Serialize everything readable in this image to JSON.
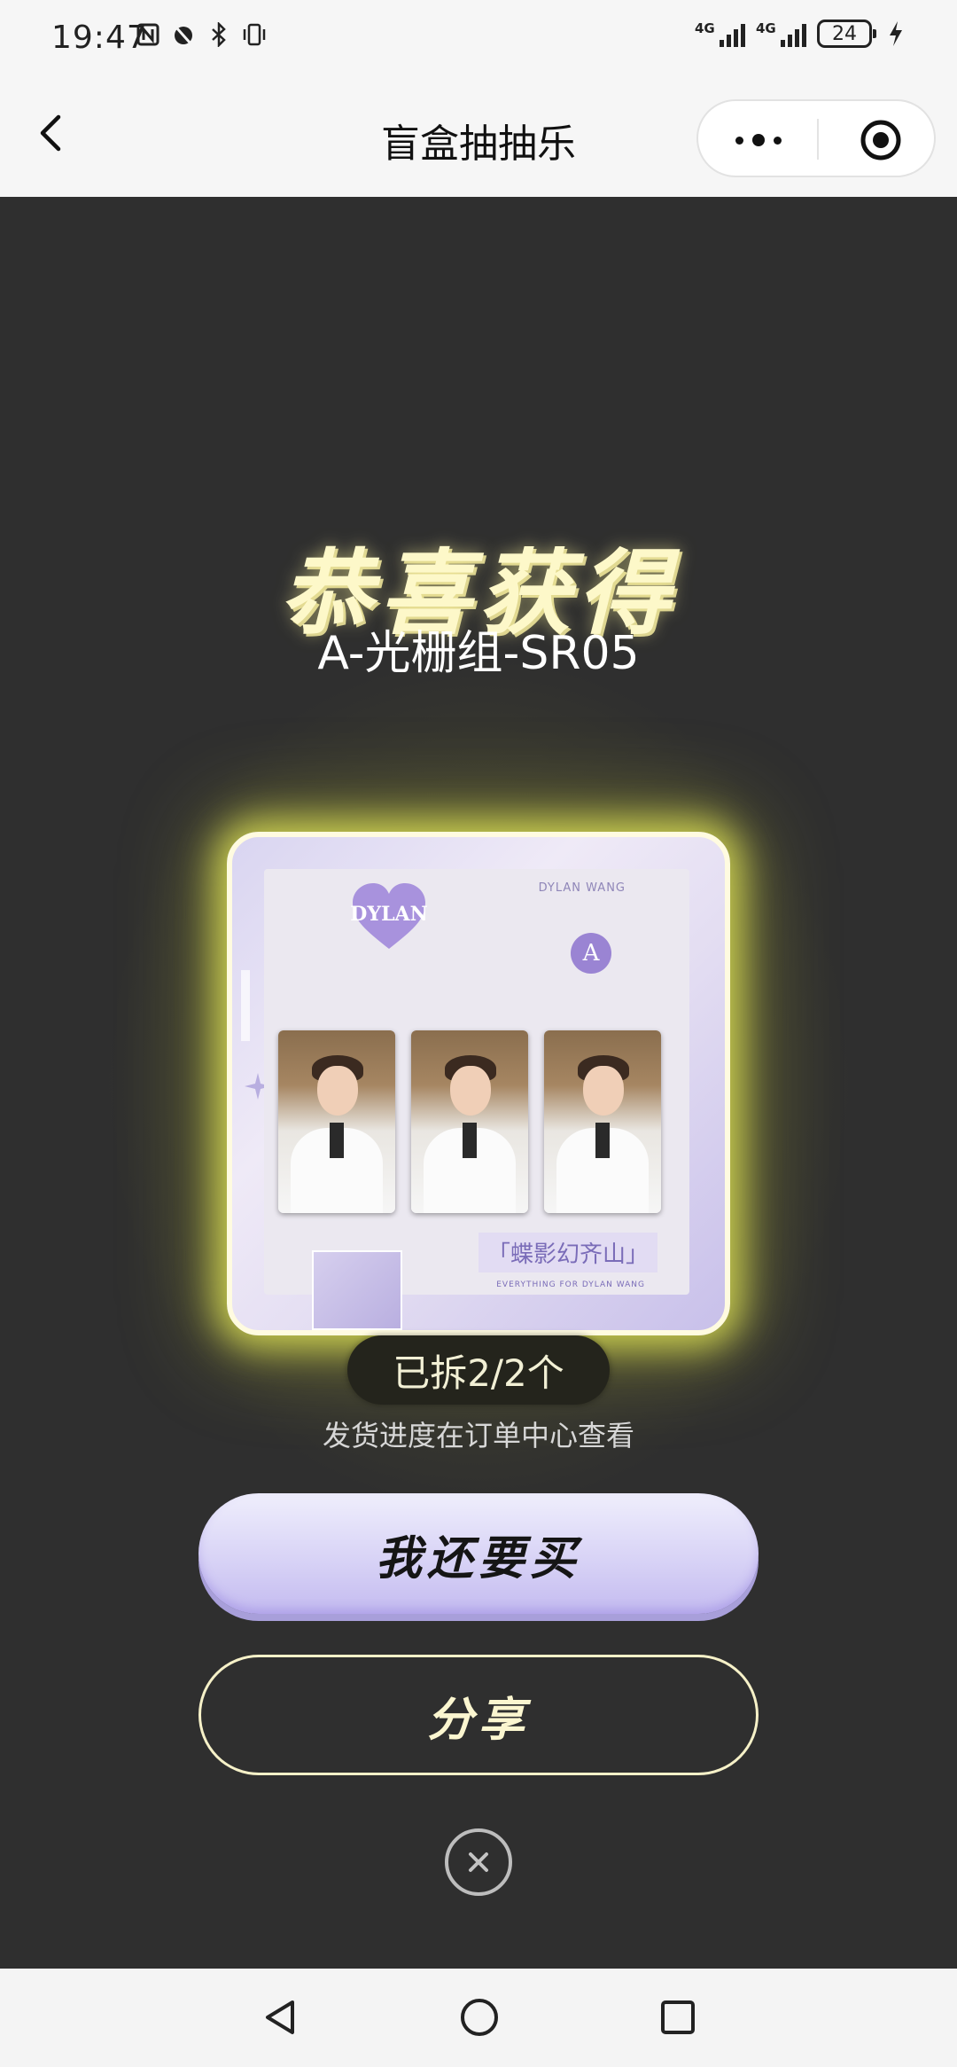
{
  "status_bar": {
    "time": "19:47",
    "network_1": "4G",
    "network_2": "4G",
    "battery": "24",
    "icons": [
      "nfc-icon",
      "alarm-icon",
      "bluetooth-icon",
      "vibrate-icon",
      "charging-icon"
    ]
  },
  "nav": {
    "title": "盲盒抽抽乐",
    "back_icon": "chevron-left-icon",
    "more_icon": "more-dots-icon",
    "target_icon": "target-icon"
  },
  "result": {
    "headline": "恭喜获得",
    "prize_name": "A-光栅组-SR05",
    "card": {
      "heart_text": "DYLAN",
      "brand_text": "DYLAN WANG",
      "badge": "A",
      "title_tag": "「蝶影幻齐山」",
      "footer_text": "EVERYTHING FOR DYLAN WANG"
    },
    "progress": "已拆2/2个",
    "hint": "发货进度在订单中心查看"
  },
  "actions": {
    "buy_again": "我还要买",
    "share": "分享",
    "close_icon": "close-icon"
  },
  "system_nav": {
    "back_icon": "triangle-back-icon",
    "home_icon": "circle-home-icon",
    "recent_icon": "square-recent-icon"
  },
  "colors": {
    "background": "#2f2f2f",
    "glow": "#e9f05a",
    "headline": "#fdf8c9",
    "buy_button": "#d8d3f6",
    "share_border": "#f6f1c8"
  }
}
